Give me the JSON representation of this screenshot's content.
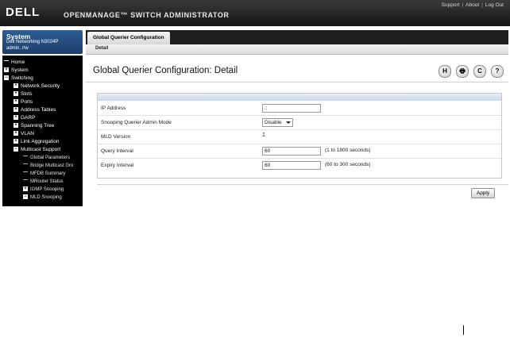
{
  "header": {
    "logo": "DELL",
    "app_title": "OPENMANAGE™ SWITCH ADMINISTRATOR",
    "links": [
      "Support",
      "About",
      "Log Out"
    ]
  },
  "system": {
    "title": "System",
    "model": "Dell Networking N3024P",
    "user": "admin, r/w"
  },
  "nav": {
    "items": [
      {
        "label": "Home",
        "level": 0,
        "marker": "none"
      },
      {
        "label": "System",
        "level": 0,
        "marker": "+"
      },
      {
        "label": "Switching",
        "level": 0,
        "marker": "-"
      },
      {
        "label": "Network Security",
        "level": 1,
        "marker": "+"
      },
      {
        "label": "Slots",
        "level": 1,
        "marker": "+"
      },
      {
        "label": "Ports",
        "level": 1,
        "marker": "+"
      },
      {
        "label": "Address Tables",
        "level": 1,
        "marker": "+"
      },
      {
        "label": "GARP",
        "level": 1,
        "marker": "+"
      },
      {
        "label": "Spanning Tree",
        "level": 1,
        "marker": "+"
      },
      {
        "label": "VLAN",
        "level": 1,
        "marker": "+"
      },
      {
        "label": "Link Aggregation",
        "level": 1,
        "marker": "+"
      },
      {
        "label": "Multicast Support",
        "level": 1,
        "marker": "-"
      },
      {
        "label": "Global Parameters",
        "level": 2,
        "marker": "line"
      },
      {
        "label": "Bridge Multicast Gro",
        "level": 2,
        "marker": "line"
      },
      {
        "label": "MFDB Summary",
        "level": 2,
        "marker": "line"
      },
      {
        "label": "MRouter Status",
        "level": 2,
        "marker": "line"
      },
      {
        "label": "IGMP Snooping",
        "level": 2,
        "marker": "+"
      },
      {
        "label": "MLD Snooping",
        "level": 2,
        "marker": "-"
      }
    ]
  },
  "tabs": {
    "active": "Global Querier Configuration",
    "subtab": "Detail"
  },
  "page": {
    "title": "Global Querier Configuration: Detail",
    "tool_icons": [
      "save-icon",
      "print-icon",
      "refresh-icon",
      "help-icon"
    ],
    "tool_glyphs": [
      "H",
      "🖶",
      "C",
      "?"
    ]
  },
  "form": {
    "ip_address": {
      "label": "IP Address",
      "value": "::"
    },
    "admin_mode": {
      "label": "Snooping Querier Admin Mode",
      "value": "Disable"
    },
    "mld_version": {
      "label": "MLD Version",
      "value": "1"
    },
    "query_interval": {
      "label": "Query Interval",
      "value": "60",
      "hint": "(1 to 1800 seconds)"
    },
    "expiry_interval": {
      "label": "Expiry Interval",
      "value": "60",
      "hint": "(60 to 300 seconds)"
    }
  },
  "actions": {
    "apply_label": "Apply"
  }
}
